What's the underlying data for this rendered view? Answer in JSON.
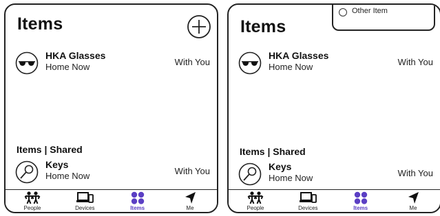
{
  "left": {
    "title": "Items",
    "items": [
      {
        "name": "HKA Glasses",
        "location": "Home Now",
        "status": "With You"
      }
    ],
    "shared_title": "Items | Shared",
    "shared_items": [
      {
        "name": "Keys",
        "location": "Home Now",
        "status": "With You"
      }
    ]
  },
  "right": {
    "title": "Items",
    "dropdown": {
      "option": "Other Item"
    },
    "items": [
      {
        "name": "HKA Glasses",
        "location": "Home Now",
        "status": "With You"
      }
    ],
    "shared_title": "Items | Shared",
    "shared_items": [
      {
        "name": "Keys",
        "location": "Home Now",
        "status": "With You"
      }
    ]
  },
  "tabs": [
    {
      "label": "People",
      "icon": "people-icon"
    },
    {
      "label": "Devices",
      "icon": "devices-icon"
    },
    {
      "label": "Items",
      "icon": "items-icon",
      "active": true
    },
    {
      "label": "Me",
      "icon": "location-arrow-icon"
    }
  ],
  "colors": {
    "accent": "#5b3fc4",
    "border": "#222222"
  }
}
